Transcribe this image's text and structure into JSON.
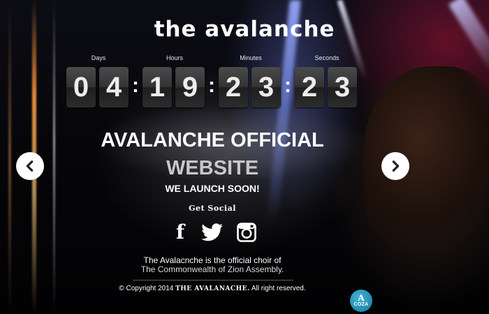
{
  "site_title": "the avalanche",
  "countdown": {
    "labels": {
      "days": "Days",
      "hours": "Hours",
      "minutes": "Minutes",
      "seconds": "Seconds"
    },
    "digits": [
      "0",
      "4",
      "1",
      "9",
      "2",
      "3",
      "2",
      "3"
    ],
    "separator": ":"
  },
  "headline": {
    "line1": "AVALANCHE OFFICIAL",
    "line2": "WEBSITE",
    "launch": "WE LAUNCH SOON!"
  },
  "social": {
    "title": "Get Social",
    "facebook_glyph": "f",
    "icons": [
      "facebook-icon",
      "twitter-icon",
      "instagram-icon"
    ]
  },
  "about": {
    "line1": "The Avalacnche is the official choir of",
    "line2": "The Commonwealth of Zion Assembly."
  },
  "footer": {
    "prefix": "© Copyright 2014",
    "brand": "THE AVALANACHE.",
    "suffix": "All right reserved."
  },
  "badge": {
    "glyph": "A",
    "label": "COZA"
  },
  "carousel": {
    "prev_icon": "chevron-left-icon",
    "next_icon": "chevron-right-icon"
  },
  "colors": {
    "badge": "#1f8fbf",
    "digit_bg": "#333333",
    "text": "#ffffff"
  }
}
